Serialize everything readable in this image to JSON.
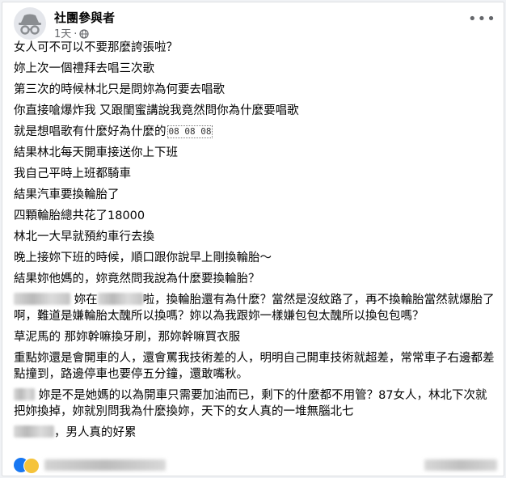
{
  "post": {
    "author": "社團參與者",
    "time": "1天",
    "meta_dot": "·",
    "more_glyph": "•••",
    "lines": {
      "l1": "女人可不可以不要那麼誇張啦？",
      "l2": "妳上次一個禮拜去唱三次歌",
      "l3": "第三次的時候林北只是問妳為何要去唱歌",
      "l4": "你直接嗆爆炸我 又跟閨蜜講說我竟然問你為什麼要唱歌",
      "l5": "就是想唱歌有什麼好為什麼的",
      "l5_emoji": "08 08 08",
      "l6": "結果林北每天開車接送你上下班",
      "l7": "我自己平時上班都騎車",
      "l8": "結果汽車要換輪胎了",
      "l9": "四顆輪胎總共花了18000",
      "l10": "林北一大早就預約車行去換",
      "l11": "晚上接妳下班的時候，順口跟你說早上剛換輪胎～",
      "l12": "結果妳他媽的，妳竟然問我說為什麼要換輪胎？",
      "p13_a": "妳在",
      "p13_b": "啦，換輪胎還有為什麼？當然是沒紋路了，再不換輪胎當然就爆胎了啊，難道是嫌輪胎太醜所以換嗎？妳以為我跟妳一樣嫌包包太醜所以換包包嗎？",
      "l14": "草泥馬的 那妳幹嘛換牙刷，那妳幹嘛買衣服",
      "p15": "重點妳還是會開車的人，還會罵我技術差的人，明明自己開車技術就超差，常常車子右邊都差點撞到，路邊停車也要停五分鐘，還敢嘴秋。",
      "p16": "妳是不是她媽的以為開車只需要加油而已，剩下的什麼都不用管？87女人，林北下次就把妳換掉，妳就別問我為什麼換妳，天下的女人真的一堆無腦北七",
      "l17": "，男人真的好累"
    }
  }
}
